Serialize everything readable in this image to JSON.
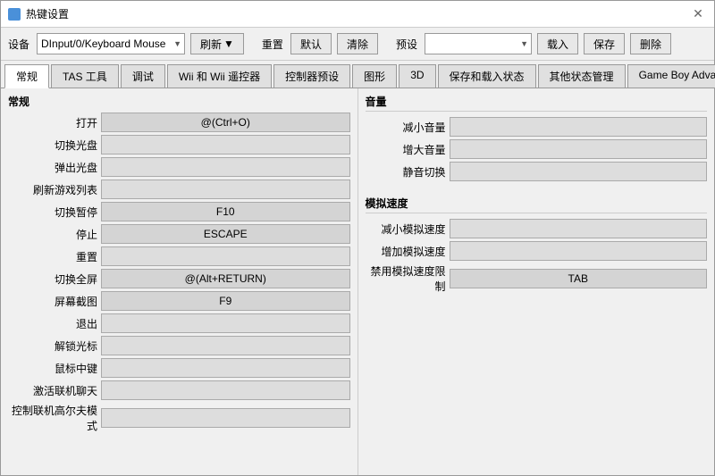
{
  "window": {
    "title": "热键设置",
    "close_label": "✕"
  },
  "toolbar": {
    "device_label": "设备",
    "device_value": "DInput/0/Keyboard Mouse",
    "refresh_label": "刷新",
    "reset_group_label": "重置",
    "default_label": "默认",
    "clear_label": "清除",
    "preset_label": "预设",
    "preset_value": "",
    "load_label": "载入",
    "save_label": "保存",
    "delete_label": "删除"
  },
  "tabs": [
    {
      "id": "general",
      "label": "常规",
      "active": true
    },
    {
      "id": "tas",
      "label": "TAS 工具",
      "active": false
    },
    {
      "id": "debug",
      "label": "调试",
      "active": false
    },
    {
      "id": "wii",
      "label": "Wii 和 Wii 遥控器",
      "active": false
    },
    {
      "id": "controller",
      "label": "控制器预设",
      "active": false
    },
    {
      "id": "graphics",
      "label": "图形",
      "active": false
    },
    {
      "id": "3d",
      "label": "3D",
      "active": false
    },
    {
      "id": "saveload",
      "label": "保存和载入状态",
      "active": false
    },
    {
      "id": "statemanage",
      "label": "其他状态管理",
      "active": false
    },
    {
      "id": "gba",
      "label": "Game Boy Advance",
      "active": false
    }
  ],
  "left_panel": {
    "section_title": "常规",
    "rows": [
      {
        "label": "打开",
        "value": "@(Ctrl+O)",
        "has_value": true
      },
      {
        "label": "切换光盘",
        "value": "",
        "has_value": false
      },
      {
        "label": "弹出光盘",
        "value": "",
        "has_value": false
      },
      {
        "label": "刷新游戏列表",
        "value": "",
        "has_value": false
      },
      {
        "label": "切换暂停",
        "value": "F10",
        "has_value": true
      },
      {
        "label": "停止",
        "value": "ESCAPE",
        "has_value": true
      },
      {
        "label": "重置",
        "value": "",
        "has_value": false
      },
      {
        "label": "切换全屏",
        "value": "@(Alt+RETURN)",
        "has_value": true
      },
      {
        "label": "屏幕截图",
        "value": "F9",
        "has_value": true
      },
      {
        "label": "退出",
        "value": "",
        "has_value": false
      },
      {
        "label": "解锁光标",
        "value": "",
        "has_value": false
      },
      {
        "label": "鼠标中键",
        "value": "",
        "has_value": false
      },
      {
        "label": "激活联机聊天",
        "value": "",
        "has_value": false
      },
      {
        "label": "控制联机高尔夫模式",
        "value": "",
        "has_value": false
      }
    ]
  },
  "right_panel": {
    "volume_section_title": "音量",
    "volume_rows": [
      {
        "label": "减小音量",
        "value": "",
        "has_value": false
      },
      {
        "label": "增大音量",
        "value": "",
        "has_value": false
      },
      {
        "label": "静音切换",
        "value": "",
        "has_value": false
      }
    ],
    "speed_section_title": "模拟速度",
    "speed_rows": [
      {
        "label": "减小模拟速度",
        "value": "",
        "has_value": false
      },
      {
        "label": "增加模拟速度",
        "value": "",
        "has_value": false
      },
      {
        "label": "禁用模拟速度限制",
        "value": "TAB",
        "has_value": true
      }
    ]
  }
}
